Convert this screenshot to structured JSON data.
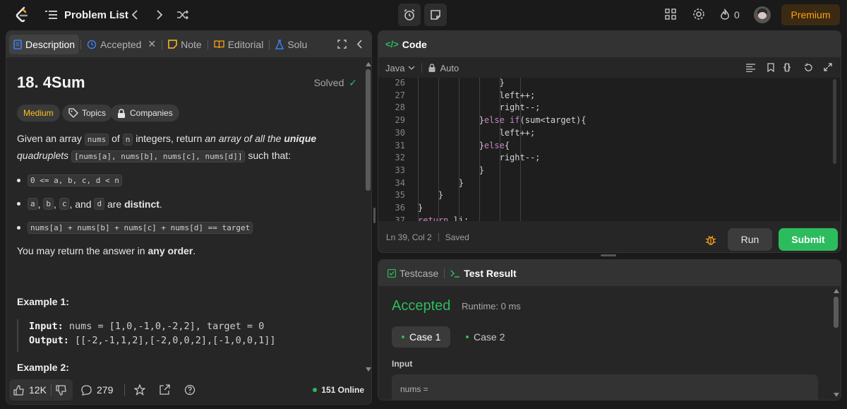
{
  "topbar": {
    "problem_list": "Problem List",
    "streak": "0",
    "premium": "Premium"
  },
  "left": {
    "tabs": {
      "description": "Description",
      "accepted": "Accepted",
      "note": "Note",
      "editorial": "Editorial",
      "solutions": "Solu"
    },
    "title": "18. 4Sum",
    "solved": "Solved",
    "difficulty": "Medium",
    "topics": "Topics",
    "companies": "Companies",
    "para1_a": "Given an array ",
    "code_nums": "nums",
    "para1_b": " of ",
    "code_n": "n",
    "para1_c": " integers, return ",
    "para1_em": "an array of all the ",
    "para1_unique": "unique",
    "para1_em2": "quadruplets",
    "code_quad": "[nums[a], nums[b], nums[c], nums[d]]",
    "para1_d": " such that:",
    "bullet1": "0 <= a, b, c, d < n",
    "b2_a": "a",
    "b2_b": "b",
    "b2_c": "c",
    "b2_and": ", and ",
    "b2_d": "d",
    "b2_are": " are ",
    "b2_distinct": "distinct",
    "bullet3": "nums[a] + nums[b] + nums[c] + nums[d] == target",
    "para2_a": "You may return the answer in ",
    "para2_b": "any order",
    "example1": "Example 1:",
    "input_label": "Input:",
    "input_value": " nums = [1,0,-1,0,-2,2], target = 0",
    "output_label": "Output:",
    "output_value": " [[-2,-1,1,2],[-2,0,0,2],[-1,0,0,1]]",
    "example2": "Example 2:",
    "likes": "12K",
    "comments": "279",
    "online": "151 Online"
  },
  "code": {
    "tab": "Code",
    "language": "Java",
    "mode": "Auto",
    "lines": [
      {
        "n": "26",
        "code": "                }"
      },
      {
        "n": "27",
        "code": "                left++;"
      },
      {
        "n": "28",
        "code": "                right--;"
      },
      {
        "n": "29",
        "code": "            }else if(sum<target){"
      },
      {
        "n": "30",
        "code": "                left++;"
      },
      {
        "n": "31",
        "code": "            }else{"
      },
      {
        "n": "32",
        "code": "                right--;"
      },
      {
        "n": "33",
        "code": "            }"
      },
      {
        "n": "34",
        "code": "        }"
      },
      {
        "n": "35",
        "code": "    }"
      },
      {
        "n": "36",
        "code": "}"
      },
      {
        "n": "37",
        "code": "return li;"
      }
    ],
    "position": "Ln 39, Col 2",
    "saved": "Saved",
    "run": "Run",
    "submit": "Submit"
  },
  "result": {
    "testcase_tab": "Testcase",
    "result_tab": "Test Result",
    "status": "Accepted",
    "runtime": "Runtime: 0 ms",
    "case1": "Case 1",
    "case2": "Case 2",
    "input_label": "Input",
    "nums_label": "nums ="
  }
}
